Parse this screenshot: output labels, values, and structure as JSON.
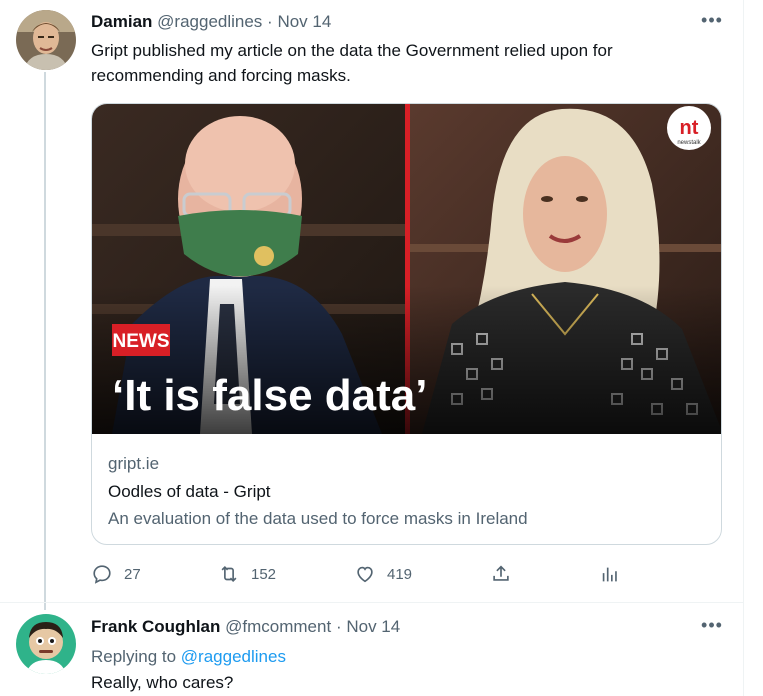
{
  "tweet1": {
    "name": "Damian",
    "handle": "@raggedlines",
    "separator": "·",
    "date": "Nov 14",
    "text": "Gript published my article on the data the Government relied upon for recommending and forcing masks.",
    "card": {
      "image": {
        "badge": "NEWS",
        "headline": "‘It is false data’",
        "logo_text": "nt",
        "logo_sub": "newstalk"
      },
      "domain": "gript.ie",
      "title": "Oodles of data - Gript",
      "description": "An evaluation of the data used to force masks in Ireland"
    },
    "actions": {
      "replies": "27",
      "retweets": "152",
      "likes": "419"
    }
  },
  "tweet2": {
    "name": "Frank Coughlan",
    "handle": "@fmcomment",
    "separator": "·",
    "date": "Nov 14",
    "replying_prefix": "Replying to",
    "replying_handle": "@raggedlines",
    "text": "Really, who cares?"
  },
  "colors": {
    "accent": "#1d9bf0",
    "secondary_text": "#536471",
    "news_red": "#d81f26"
  }
}
